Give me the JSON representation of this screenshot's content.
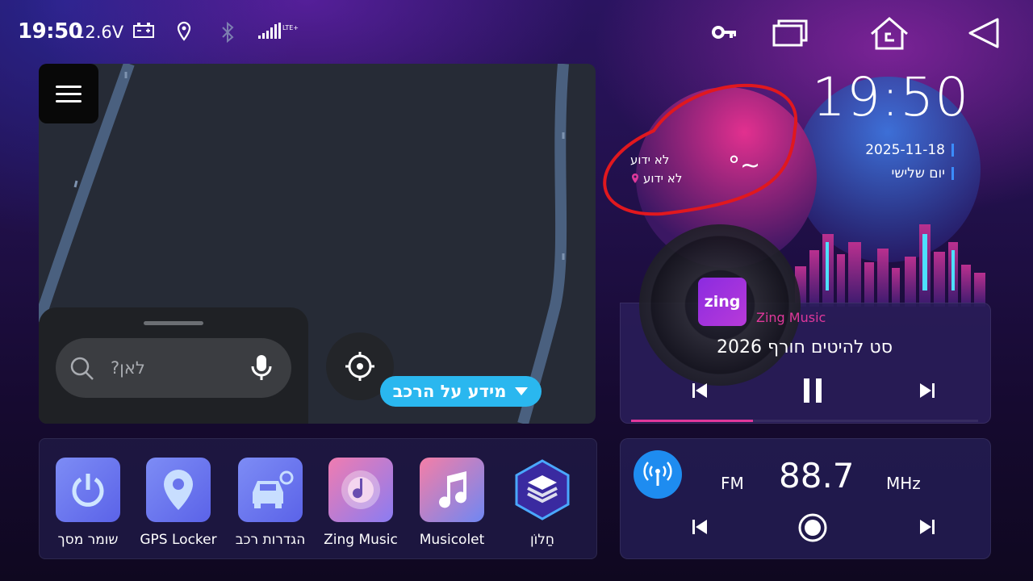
{
  "status": {
    "time": "19:50",
    "voltage": "12.6V",
    "network": "LTE+"
  },
  "map": {
    "search_placeholder": "לאן?",
    "vehicle_info_label": "מידע על הרכב"
  },
  "weather": {
    "location_unknown": "לא ידוע",
    "condition_unknown": "לא ידוע",
    "temperature": "°~"
  },
  "clock": {
    "time": "19:50",
    "date": "2025-11-18",
    "day": "יום שלישי"
  },
  "music": {
    "app_icon_text": "zing",
    "app_name": "Zing Music",
    "song_title": "סט להיטים חורף 2026",
    "progress": 0.35
  },
  "radio": {
    "band": "FM",
    "frequency": "88.7",
    "unit": "MHz"
  },
  "apps": [
    {
      "label": "שומר מסך",
      "icon": "power-icon"
    },
    {
      "label": "GPS Locker",
      "icon": "location-pin-icon"
    },
    {
      "label": "הגדרות רכב",
      "icon": "car-settings-icon"
    },
    {
      "label": "Zing Music",
      "icon": "music-disc-icon"
    },
    {
      "label": "Musicolet",
      "icon": "music-note-icon"
    },
    {
      "label": "חַלוֹן",
      "icon": "layers-icon"
    }
  ],
  "colors": {
    "accent_pink": "#e0389b",
    "accent_blue": "#2ab7ef",
    "radio_blue": "#1e8cf0"
  }
}
